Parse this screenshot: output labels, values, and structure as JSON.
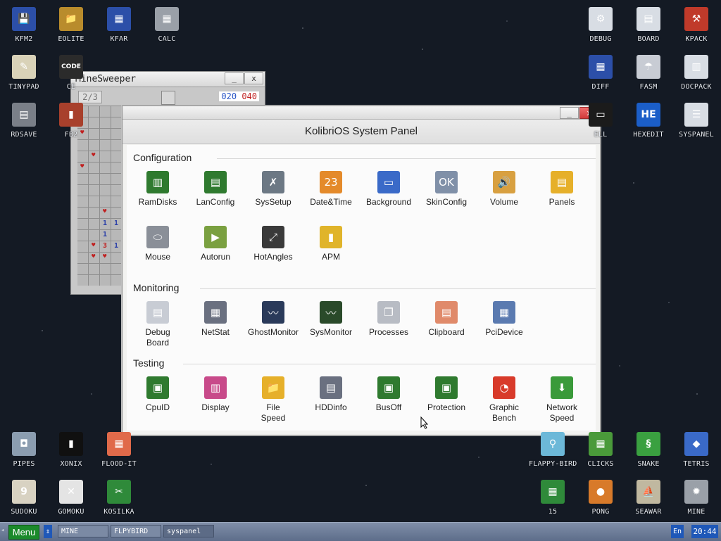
{
  "desktop": {
    "left_icons": [
      {
        "label": "KFM2",
        "glyph": "💾",
        "color": "#2c4fa8"
      },
      {
        "label": "EOLITE",
        "glyph": "📁",
        "color": "#b98c2c"
      },
      {
        "label": "KFAR",
        "glyph": "▦",
        "color": "#2c4fa8"
      },
      {
        "label": "CALC",
        "glyph": "▦",
        "color": "#9aa0a8"
      },
      {
        "label": "TINYPAD",
        "glyph": "✎",
        "color": "#d9d2b8"
      },
      {
        "label": "CE",
        "glyph": "CODE",
        "color": "#2b2b2b"
      },
      {
        "label": "RDSAVE",
        "glyph": "▤",
        "color": "#7a7f88"
      },
      {
        "label": "FB2",
        "glyph": "▮",
        "color": "#a8402c"
      }
    ],
    "right_icons": [
      {
        "label": "DEBUG",
        "glyph": "⚙",
        "color": "#d8dde4"
      },
      {
        "label": "BOARD",
        "glyph": "▤",
        "color": "#d8dde4"
      },
      {
        "label": "KPACK",
        "glyph": "⚒",
        "color": "#c03a2a"
      },
      {
        "label": "DIFF",
        "glyph": "▦",
        "color": "#2c4fa8"
      },
      {
        "label": "FASM",
        "glyph": "☂",
        "color": "#c8ccd4"
      },
      {
        "label": "DOCPACK",
        "glyph": "▥",
        "color": "#d8dde4"
      },
      {
        "label": "ELL",
        "glyph": "▭",
        "color": "#1b1b1b"
      },
      {
        "label": "HEXEDIT",
        "glyph": "HE",
        "color": "#1b5ec8"
      },
      {
        "label": "SYSPANEL",
        "glyph": "☰",
        "color": "#d8dde4"
      }
    ],
    "bottom_left_icons": [
      {
        "label": "PIPES",
        "glyph": "◘",
        "color": "#8b9db0"
      },
      {
        "label": "XONIX",
        "glyph": "▮",
        "color": "#101010"
      },
      {
        "label": "FLOOD-IT",
        "glyph": "▦",
        "color": "#e06a4a"
      },
      {
        "label": "SUDOKU",
        "glyph": "9",
        "color": "#d8d2c2"
      },
      {
        "label": "GOMOKU",
        "glyph": "✕",
        "color": "#e4e4e4"
      },
      {
        "label": "KOSILKA",
        "glyph": "✂",
        "color": "#2f8a3a"
      }
    ],
    "bottom_right_icons": [
      {
        "label": "FLAPPY-BIRD",
        "glyph": "⚲",
        "color": "#6cb8d8"
      },
      {
        "label": "CLICKS",
        "glyph": "▦",
        "color": "#4a9a3a"
      },
      {
        "label": "SNAKE",
        "glyph": "§",
        "color": "#3aa040"
      },
      {
        "label": "TETRIS",
        "glyph": "◆",
        "color": "#3a6ac8"
      },
      {
        "label": "15",
        "glyph": "▦",
        "color": "#2f8a3a"
      },
      {
        "label": "PONG",
        "glyph": "●",
        "color": "#d87a2a"
      },
      {
        "label": "SEAWAR",
        "glyph": "⛵",
        "color": "#c0b8a0"
      },
      {
        "label": "MINE",
        "glyph": "✹",
        "color": "#9aa0a8"
      }
    ]
  },
  "minesweeper": {
    "title": "MineSweeper",
    "counter": "2/3",
    "time_left": "020",
    "time_right": "040",
    "minimize": "_",
    "close": "x"
  },
  "syspanel": {
    "title": "KolibriOS System Panel",
    "minimize": "_",
    "close": "x",
    "sections": [
      {
        "title": "Configuration",
        "apps": [
          {
            "label": "RamDisks",
            "glyph": "▥",
            "color": "#2f7a2f"
          },
          {
            "label": "LanConfig",
            "glyph": "▤",
            "color": "#2f7a2f"
          },
          {
            "label": "SysSetup",
            "glyph": "✗",
            "color": "#6c7884"
          },
          {
            "label": "Date&Time",
            "glyph": "23",
            "color": "#e48a2a"
          },
          {
            "label": "Background",
            "glyph": "▭",
            "color": "#3a6ac8"
          },
          {
            "label": "SkinConfig",
            "glyph": "OK",
            "color": "#8090a8"
          },
          {
            "label": "Volume",
            "glyph": "🔊",
            "color": "#d8a040"
          },
          {
            "label": "Panels",
            "glyph": "▤",
            "color": "#e6b02a"
          },
          {
            "label": "Mouse",
            "glyph": "⬭",
            "color": "#8a8f98"
          },
          {
            "label": "Autorun",
            "glyph": "▶",
            "color": "#7aa040"
          },
          {
            "label": "HotAngles",
            "glyph": "⤢",
            "color": "#3a3a3a"
          },
          {
            "label": "APM",
            "glyph": "▮",
            "color": "#e0b42a"
          }
        ]
      },
      {
        "title": "Monitoring",
        "apps": [
          {
            "label": "Debug\nBoard",
            "glyph": "▤",
            "color": "#c8ccd4"
          },
          {
            "label": "NetStat",
            "glyph": "▦",
            "color": "#6a7080"
          },
          {
            "label": "GhostMonitor",
            "glyph": "〰",
            "color": "#2a3a5a"
          },
          {
            "label": "SysMonitor",
            "glyph": "〰",
            "color": "#2a4a2a"
          },
          {
            "label": "Processes",
            "glyph": "❐",
            "color": "#b8bcc4"
          },
          {
            "label": "Clipboard",
            "glyph": "▤",
            "color": "#e08a6a"
          },
          {
            "label": "PciDevice",
            "glyph": "▦",
            "color": "#5a7ab0"
          }
        ]
      },
      {
        "title": "Testing",
        "apps": [
          {
            "label": "CpuID",
            "glyph": "▣",
            "color": "#2f7a2f"
          },
          {
            "label": "Display",
            "glyph": "▥",
            "color": "#c84a8a"
          },
          {
            "label": "File\nSpeed",
            "glyph": "📁",
            "color": "#e6b02a"
          },
          {
            "label": "HDDinfo",
            "glyph": "▤",
            "color": "#6a7080"
          },
          {
            "label": "BusOff",
            "glyph": "▣",
            "color": "#2f7a2f"
          },
          {
            "label": "Protection",
            "glyph": "▣",
            "color": "#2f7a2f"
          },
          {
            "label": "Graphic\nBench",
            "glyph": "◔",
            "color": "#d83a2a"
          },
          {
            "label": "Network\nSpeed",
            "glyph": "⬇",
            "color": "#3a9a3a"
          }
        ]
      }
    ]
  },
  "taskbar": {
    "menu_label": "Menu",
    "switch_glyph": "⇕",
    "tasks": [
      "MINE",
      "FLPYBIRD",
      "syspanel"
    ],
    "lang": "En",
    "clock": "20:44"
  }
}
